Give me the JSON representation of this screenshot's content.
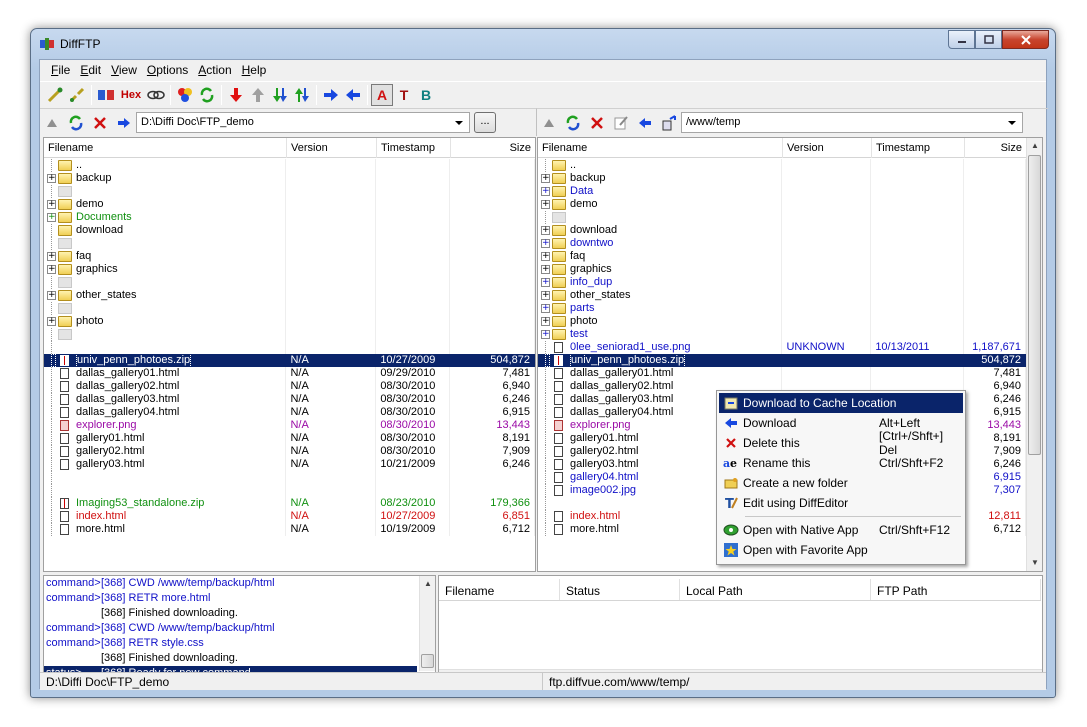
{
  "window": {
    "title": "DiffFTP"
  },
  "menu": [
    "File",
    "Edit",
    "View",
    "Options",
    "Action",
    "Help"
  ],
  "toolbar": {
    "hex": "Hex",
    "a": "A",
    "t": "T",
    "b": "B"
  },
  "left_path": {
    "value": "D:\\Diffi Doc\\FTP_demo",
    "browse": "..."
  },
  "right_path": {
    "value": "/www/temp"
  },
  "columns": {
    "filename": "Filename",
    "version": "Version",
    "timestamp": "Timestamp",
    "size": "Size"
  },
  "left_rows": [
    {
      "name": "..",
      "type": "folder",
      "exp": false,
      "color": "black"
    },
    {
      "name": "backup",
      "type": "folder",
      "exp": true,
      "color": "black"
    },
    {
      "name": "",
      "type": "ghost",
      "exp": false,
      "color": "black"
    },
    {
      "name": "demo",
      "type": "folder",
      "exp": true,
      "color": "black"
    },
    {
      "name": "Documents",
      "type": "folder",
      "exp": true,
      "color": "green"
    },
    {
      "name": "download",
      "type": "folder",
      "exp": false,
      "color": "black"
    },
    {
      "name": "",
      "type": "ghost",
      "exp": false,
      "color": "black"
    },
    {
      "name": "faq",
      "type": "folder",
      "exp": true,
      "color": "black"
    },
    {
      "name": "graphics",
      "type": "folder",
      "exp": true,
      "color": "black"
    },
    {
      "name": "",
      "type": "ghost",
      "exp": false,
      "color": "black"
    },
    {
      "name": "other_states",
      "type": "folder",
      "exp": true,
      "color": "black"
    },
    {
      "name": "",
      "type": "ghost",
      "exp": false,
      "color": "black"
    },
    {
      "name": "photo",
      "type": "folder",
      "exp": true,
      "color": "black"
    },
    {
      "name": "",
      "type": "ghost",
      "exp": false,
      "color": "black"
    },
    {
      "name": "",
      "type": "blank",
      "exp": false,
      "color": "black"
    },
    {
      "name": "univ_penn_photoes.zip",
      "type": "zip",
      "exp": false,
      "color": "purple",
      "version": "N/A",
      "timestamp": "10/27/2009",
      "size": "504,872",
      "selected": true
    },
    {
      "name": "dallas_gallery01.html",
      "type": "file",
      "exp": false,
      "color": "black",
      "version": "N/A",
      "timestamp": "09/29/2010",
      "size": "7,481"
    },
    {
      "name": "dallas_gallery02.html",
      "type": "file",
      "exp": false,
      "color": "black",
      "version": "N/A",
      "timestamp": "08/30/2010",
      "size": "6,940"
    },
    {
      "name": "dallas_gallery03.html",
      "type": "file",
      "exp": false,
      "color": "black",
      "version": "N/A",
      "timestamp": "08/30/2010",
      "size": "6,246"
    },
    {
      "name": "dallas_gallery04.html",
      "type": "file",
      "exp": false,
      "color": "black",
      "version": "N/A",
      "timestamp": "08/30/2010",
      "size": "6,915"
    },
    {
      "name": "explorer.png",
      "type": "img",
      "exp": false,
      "color": "purple",
      "version": "N/A",
      "timestamp": "08/30/2010",
      "size": "13,443"
    },
    {
      "name": "gallery01.html",
      "type": "file",
      "exp": false,
      "color": "black",
      "version": "N/A",
      "timestamp": "08/30/2010",
      "size": "8,191"
    },
    {
      "name": "gallery02.html",
      "type": "file",
      "exp": false,
      "color": "black",
      "version": "N/A",
      "timestamp": "08/30/2010",
      "size": "7,909"
    },
    {
      "name": "gallery03.html",
      "type": "file",
      "exp": false,
      "color": "black",
      "version": "N/A",
      "timestamp": "10/21/2009",
      "size": "6,246"
    },
    {
      "name": "",
      "type": "blank",
      "exp": false,
      "color": "black"
    },
    {
      "name": "",
      "type": "blank",
      "exp": false,
      "color": "black"
    },
    {
      "name": "Imaging53_standalone.zip",
      "type": "zip",
      "exp": false,
      "color": "green",
      "version": "N/A",
      "timestamp": "08/23/2010",
      "size": "179,366"
    },
    {
      "name": "index.html",
      "type": "file",
      "exp": false,
      "color": "red",
      "version": "N/A",
      "timestamp": "10/27/2009",
      "size": "6,851"
    },
    {
      "name": "more.html",
      "type": "file",
      "exp": false,
      "color": "black",
      "version": "N/A",
      "timestamp": "10/19/2009",
      "size": "6,712"
    }
  ],
  "right_rows": [
    {
      "name": "..",
      "type": "folder",
      "exp": false,
      "color": "black"
    },
    {
      "name": "backup",
      "type": "folder",
      "exp": true,
      "color": "black"
    },
    {
      "name": "Data",
      "type": "folder",
      "exp": true,
      "color": "blue"
    },
    {
      "name": "demo",
      "type": "folder",
      "exp": true,
      "color": "black"
    },
    {
      "name": "",
      "type": "ghost",
      "exp": false,
      "color": "black"
    },
    {
      "name": "download",
      "type": "folder",
      "exp": true,
      "color": "black"
    },
    {
      "name": "downtwo",
      "type": "folder",
      "exp": true,
      "color": "blue"
    },
    {
      "name": "faq",
      "type": "folder",
      "exp": true,
      "color": "black"
    },
    {
      "name": "graphics",
      "type": "folder",
      "exp": true,
      "color": "black"
    },
    {
      "name": "info_dup",
      "type": "folder",
      "exp": true,
      "color": "blue"
    },
    {
      "name": "other_states",
      "type": "folder",
      "exp": true,
      "color": "black"
    },
    {
      "name": "parts",
      "type": "folder",
      "exp": true,
      "color": "blue"
    },
    {
      "name": "photo",
      "type": "folder",
      "exp": true,
      "color": "black"
    },
    {
      "name": "test",
      "type": "folder",
      "exp": true,
      "color": "blue"
    },
    {
      "name": "0lee_seniorad1_use.png",
      "type": "file",
      "exp": false,
      "color": "blue",
      "version": "UNKNOWN",
      "timestamp": "10/13/2011",
      "size": "1,187,671"
    },
    {
      "name": "univ_penn_photoes.zip",
      "type": "zip",
      "exp": false,
      "color": "purple",
      "version": "",
      "timestamp": "",
      "size": "504,872",
      "selected": true
    },
    {
      "name": "dallas_gallery01.html",
      "type": "file",
      "exp": false,
      "color": "black",
      "version": "",
      "timestamp": "",
      "size": "7,481"
    },
    {
      "name": "dallas_gallery02.html",
      "type": "file",
      "exp": false,
      "color": "black",
      "version": "",
      "timestamp": "",
      "size": "6,940"
    },
    {
      "name": "dallas_gallery03.html",
      "type": "file",
      "exp": false,
      "color": "black",
      "version": "",
      "timestamp": "",
      "size": "6,246"
    },
    {
      "name": "dallas_gallery04.html",
      "type": "file",
      "exp": false,
      "color": "black",
      "version": "",
      "timestamp": "",
      "size": "6,915"
    },
    {
      "name": "explorer.png",
      "type": "img",
      "exp": false,
      "color": "purple",
      "version": "",
      "timestamp": "",
      "size": "13,443"
    },
    {
      "name": "gallery01.html",
      "type": "file",
      "exp": false,
      "color": "black",
      "version": "",
      "timestamp": "",
      "size": "8,191"
    },
    {
      "name": "gallery02.html",
      "type": "file",
      "exp": false,
      "color": "black",
      "version": "",
      "timestamp": "",
      "size": "7,909"
    },
    {
      "name": "gallery03.html",
      "type": "file",
      "exp": false,
      "color": "black",
      "version": "",
      "timestamp": "",
      "size": "6,246"
    },
    {
      "name": "gallery04.html",
      "type": "file",
      "exp": false,
      "color": "blue",
      "version": "",
      "timestamp": "",
      "size": "6,915"
    },
    {
      "name": "image002.jpg",
      "type": "file",
      "exp": false,
      "color": "blue",
      "version": "",
      "timestamp": "",
      "size": "7,307"
    },
    {
      "name": "",
      "type": "blank",
      "exp": false,
      "color": "black"
    },
    {
      "name": "index.html",
      "type": "file",
      "exp": false,
      "color": "red",
      "version": "",
      "timestamp": "",
      "size": "12,811"
    },
    {
      "name": "more.html",
      "type": "file",
      "exp": false,
      "color": "black",
      "version": "N/A",
      "timestamp": "10/19/2009",
      "size": "6,712"
    }
  ],
  "context_menu": [
    {
      "label": "Download to Cache Location",
      "shortcut": "",
      "icon": "cache-download-icon",
      "highlighted": true
    },
    {
      "label": "Download",
      "shortcut": "Alt+Left",
      "icon": "arrow-left-icon"
    },
    {
      "label": "Delete this",
      "shortcut": "[Ctrl+/Shft+] Del",
      "icon": "delete-x-icon"
    },
    {
      "label": "Rename this",
      "shortcut": "Ctrl/Shft+F2",
      "icon": "rename-icon"
    },
    {
      "label": "Create a new folder",
      "shortcut": "",
      "icon": "new-folder-icon"
    },
    {
      "label": "Edit using DiffEditor",
      "shortcut": "",
      "icon": "edit-icon"
    },
    {
      "separator": true
    },
    {
      "label": "Open with Native App",
      "shortcut": "Ctrl/Shft+F12",
      "icon": "native-app-icon"
    },
    {
      "label": "Open with Favorite App",
      "shortcut": "",
      "icon": "favorite-app-icon"
    }
  ],
  "log": [
    {
      "prefix": "command>",
      "text": "[368] CWD /www/temp/backup/html",
      "kind": "cmd"
    },
    {
      "prefix": "command>",
      "text": "[368] RETR more.html",
      "kind": "cmd"
    },
    {
      "prefix": "",
      "text": "[368] Finished downloading.",
      "kind": "info"
    },
    {
      "prefix": "command>",
      "text": "[368] CWD /www/temp/backup/html",
      "kind": "cmd"
    },
    {
      "prefix": "command>",
      "text": "[368] RETR style.css",
      "kind": "cmd"
    },
    {
      "prefix": "",
      "text": "[368] Finished downloading.",
      "kind": "info"
    },
    {
      "prefix": "status>",
      "text": "[368] Ready for new command.",
      "kind": "status"
    }
  ],
  "queue_columns": [
    "Filename",
    "Status",
    "Local Path",
    "FTP Path"
  ],
  "status": {
    "left": "D:\\Diffi Doc\\FTP_demo",
    "right": "ftp.diffvue.com/www/temp/"
  },
  "colors": {
    "black": "#000000",
    "blue": "#1010c8",
    "green": "#109010",
    "red": "#d01010",
    "purple": "#9a0aa6",
    "selection": "#0a246a"
  }
}
